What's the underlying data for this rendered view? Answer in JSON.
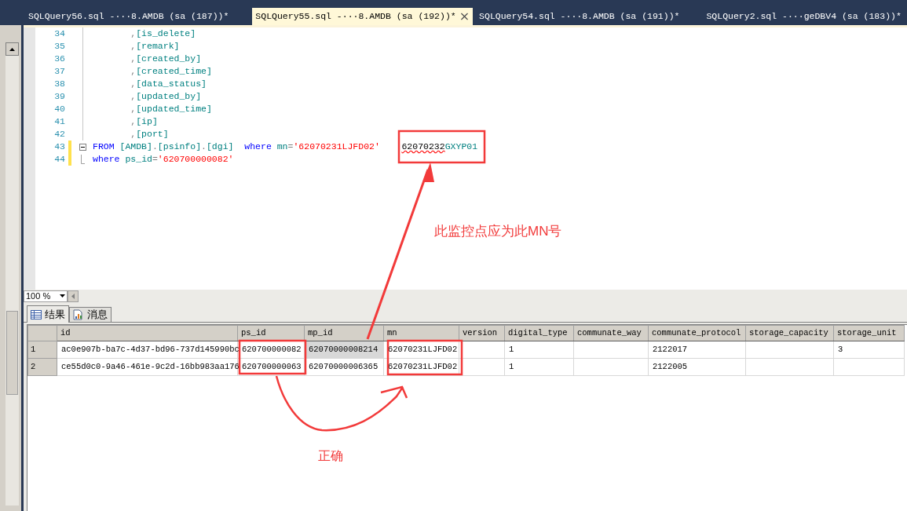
{
  "tabs": [
    {
      "label": "SQLQuery56.sql -···8.AMDB (sa (187))*",
      "selected": false
    },
    {
      "label": "SQLQuery55.sql -···8.AMDB (sa (192))*",
      "selected": true
    },
    {
      "label": "SQLQuery54.sql -···8.AMDB (sa (191))*",
      "selected": false
    },
    {
      "label": "SQLQuery2.sql -···geDBV4 (sa (183))*",
      "selected": false
    }
  ],
  "close_button": "×",
  "editor": {
    "lines": [
      {
        "number": "34",
        "changed": false,
        "fold_start": false,
        "fold_end": false,
        "tokens": [
          {
            "kind": "plain",
            "text": "       ,"
          },
          {
            "kind": "ident",
            "text": "[is_delete]"
          }
        ]
      },
      {
        "number": "35",
        "changed": false,
        "fold_start": false,
        "fold_end": false,
        "tokens": [
          {
            "kind": "plain",
            "text": "       ,"
          },
          {
            "kind": "ident",
            "text": "[remark]"
          }
        ]
      },
      {
        "number": "36",
        "changed": false,
        "fold_start": false,
        "fold_end": false,
        "tokens": [
          {
            "kind": "plain",
            "text": "       ,"
          },
          {
            "kind": "ident",
            "text": "[created_by]"
          }
        ]
      },
      {
        "number": "37",
        "changed": false,
        "fold_start": false,
        "fold_end": false,
        "tokens": [
          {
            "kind": "plain",
            "text": "       ,"
          },
          {
            "kind": "ident",
            "text": "[created_time]"
          }
        ]
      },
      {
        "number": "38",
        "changed": false,
        "fold_start": false,
        "fold_end": false,
        "tokens": [
          {
            "kind": "plain",
            "text": "       ,"
          },
          {
            "kind": "ident",
            "text": "[data_status]"
          }
        ]
      },
      {
        "number": "39",
        "changed": false,
        "fold_start": false,
        "fold_end": false,
        "tokens": [
          {
            "kind": "plain",
            "text": "       ,"
          },
          {
            "kind": "ident",
            "text": "[updated_by]"
          }
        ]
      },
      {
        "number": "40",
        "changed": false,
        "fold_start": false,
        "fold_end": false,
        "tokens": [
          {
            "kind": "plain",
            "text": "       ,"
          },
          {
            "kind": "ident",
            "text": "[updated_time]"
          }
        ]
      },
      {
        "number": "41",
        "changed": false,
        "fold_start": false,
        "fold_end": false,
        "tokens": [
          {
            "kind": "plain",
            "text": "       ,"
          },
          {
            "kind": "ident",
            "text": "[ip]"
          }
        ]
      },
      {
        "number": "42",
        "changed": false,
        "fold_start": false,
        "fold_end": false,
        "tokens": [
          {
            "kind": "plain",
            "text": "       ,"
          },
          {
            "kind": "ident",
            "text": "[port]"
          }
        ]
      },
      {
        "number": "43",
        "changed": true,
        "fold_start": true,
        "fold_end": false,
        "tokens": [
          {
            "kind": "keyword",
            "text": "FROM "
          },
          {
            "kind": "ident",
            "text": "[AMDB]"
          },
          {
            "kind": "plain",
            "text": "."
          },
          {
            "kind": "ident",
            "text": "[psinfo]"
          },
          {
            "kind": "plain",
            "text": "."
          },
          {
            "kind": "ident",
            "text": "[dgi]"
          },
          {
            "kind": "keyword",
            "text": "  where "
          },
          {
            "kind": "ident",
            "text": "mn"
          },
          {
            "kind": "plain",
            "text": "="
          },
          {
            "kind": "string",
            "text": "'62070231LJFD02'    "
          },
          {
            "kind": "error",
            "text": "62070232"
          },
          {
            "kind": "ident",
            "text": "GXYP01"
          }
        ]
      },
      {
        "number": "44",
        "changed": true,
        "fold_start": false,
        "fold_end": true,
        "tokens": [
          {
            "kind": "keyword",
            "text": "where "
          },
          {
            "kind": "ident",
            "text": "ps_id"
          },
          {
            "kind": "plain",
            "text": "="
          },
          {
            "kind": "string",
            "text": "'620700000082'"
          }
        ]
      }
    ]
  },
  "zoom": "100 %",
  "result_tabs": [
    {
      "label": "结果",
      "kind": "grid",
      "selected": true
    },
    {
      "label": "消息",
      "kind": "messages",
      "selected": false
    }
  ],
  "table": {
    "columns": [
      "id",
      "ps_id",
      "mp_id",
      "mn",
      "version",
      "digital_type",
      "communate_way",
      "communate_protocol",
      "storage_capacity",
      "storage_unit"
    ],
    "rows": [
      {
        "number": "1",
        "cells": [
          {
            "text": "ac0e907b-ba7c-4d37-bd96-737d145990bc",
            "focused": false
          },
          {
            "text": "620700000082",
            "focused": false
          },
          {
            "text": "62070000008214",
            "focused": true
          },
          {
            "text": "62070231LJFD02",
            "focused": false
          },
          {
            "focused": false
          },
          {
            "text": "1",
            "focused": false
          },
          {
            "focused": false
          },
          {
            "text": "2122017",
            "focused": false
          },
          {
            "focused": false
          },
          {
            "text": "3",
            "focused": false
          }
        ]
      },
      {
        "number": "2",
        "cells": [
          {
            "text": "ce55d0c0-9a46-461e-9c2d-16bb983aa176",
            "focused": false
          },
          {
            "text": "620700000063",
            "focused": false
          },
          {
            "text": "62070000006365",
            "focused": false
          },
          {
            "text": "62070231LJFD02",
            "focused": false
          },
          {
            "focused": false
          },
          {
            "text": "1",
            "focused": false
          },
          {
            "focused": false
          },
          {
            "text": "2122005",
            "focused": false
          },
          {
            "focused": false
          },
          {
            "focused": false
          }
        ]
      }
    ]
  },
  "annotations": [
    "此监控点应为此MN号",
    "正确"
  ]
}
